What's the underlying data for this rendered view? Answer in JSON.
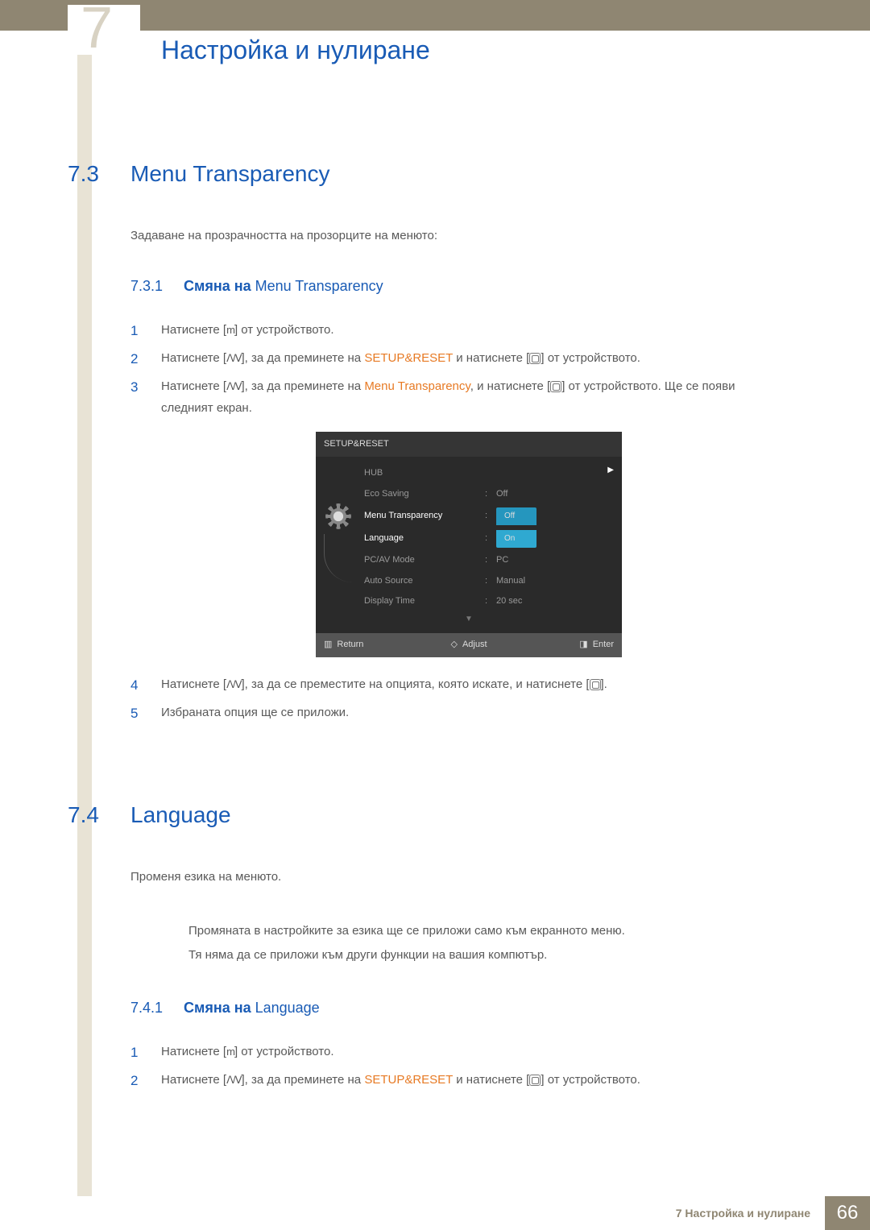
{
  "chapter": {
    "number": "7",
    "title": "Настройка и нулиране"
  },
  "section73": {
    "num": "7.3",
    "title": "Menu Transparency",
    "intro": "Задаване на прозрачността на прозорците на менюто:",
    "sub": {
      "num": "7.3.1",
      "bold": "Смяна на",
      "rest": " Menu Transparency"
    },
    "steps": {
      "s1a": "Натиснете [",
      "s1b": "] от устройството.",
      "m": "m",
      "updown": "ꓥ/ꓦ",
      "s2a": "Натиснете [",
      "s2b": "], за да преминете на ",
      "s2c": "SETUP&RESET",
      "s2d": " и натиснете [",
      "s2e": "] от устройството.",
      "s3a": "Натиснете [",
      "s3b": "], за да преминете на ",
      "s3c": "Menu Transparency",
      "s3d": ", и натиснете [",
      "s3e": "] от устройството. Ще се появи следният екран.",
      "s4a": "Натиснете [",
      "s4b": "], за да се преместите на опцията, която искате, и натиснете [",
      "s4c": "].",
      "s5": "Избраната опция ще се приложи.",
      "n1": "1",
      "n2": "2",
      "n3": "3",
      "n4": "4",
      "n5": "5"
    }
  },
  "osd": {
    "title": "SETUP&RESET",
    "rows": [
      {
        "label": "HUB",
        "value": ""
      },
      {
        "label": "Eco Saving",
        "value": "Off"
      },
      {
        "label": "Menu Transparency",
        "pill_top": "Off",
        "pill_bot": "On",
        "hl": true
      },
      {
        "label": "Language",
        "value": ""
      },
      {
        "label": "PC/AV Mode",
        "value": "PC"
      },
      {
        "label": "Auto Source",
        "value": "Manual"
      },
      {
        "label": "Display Time",
        "value": "20 sec"
      }
    ],
    "foot": {
      "return": "Return",
      "adjust": "Adjust",
      "enter": "Enter"
    }
  },
  "section74": {
    "num": "7.4",
    "title": "Language",
    "intro": "Променя езика на менюто.",
    "note1": "Промяната в настройките за езика ще се приложи само към екранното меню.",
    "note2": "Тя няма да се приложи към други функции на вашия компютър.",
    "sub": {
      "num": "7.4.1",
      "bold": "Смяна на",
      "rest": " Language"
    },
    "steps": {
      "s1a": "Натиснете [",
      "s1b": "] от устройството.",
      "m": "m",
      "updown": "ꓥ/ꓦ",
      "s2a": "Натиснете [",
      "s2b": "], за да преминете на ",
      "s2c": "SETUP&RESET",
      "s2d": " и натиснете [",
      "s2e": "] от устройството.",
      "n1": "1",
      "n2": "2"
    }
  },
  "footer": {
    "label": "7 Настройка и нулиране",
    "page": "66"
  }
}
